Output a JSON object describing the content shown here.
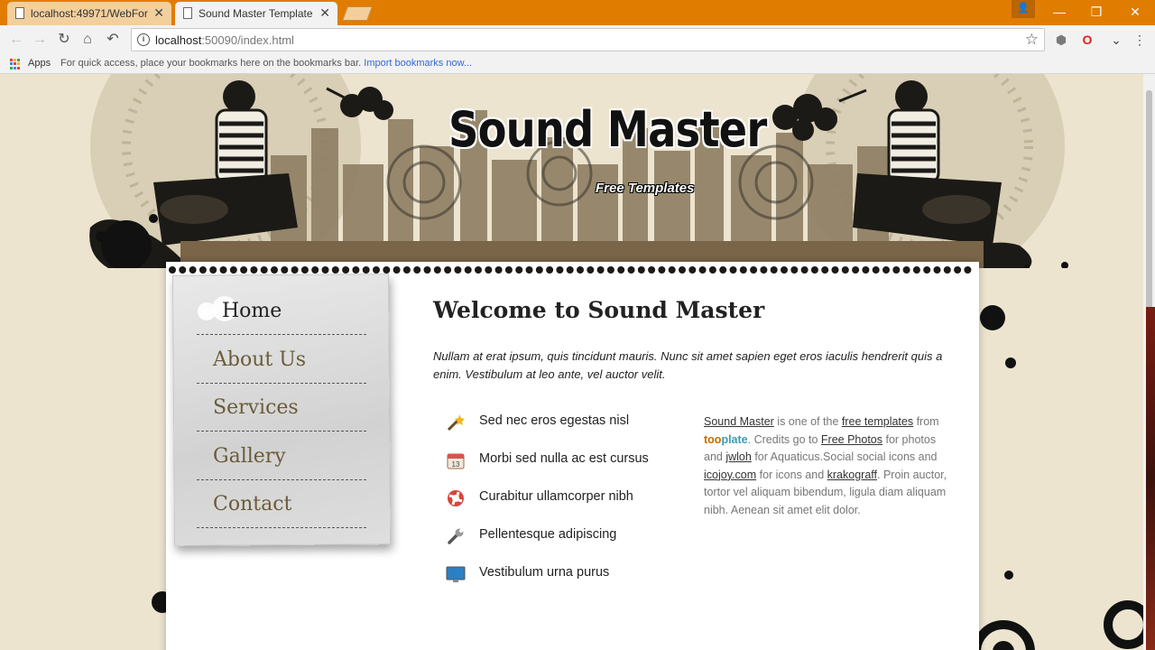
{
  "browser": {
    "tabs": [
      {
        "title": "localhost:49971/WebFor",
        "active": false
      },
      {
        "title": "Sound Master Template",
        "active": true
      }
    ],
    "url_host": "localhost",
    "url_rest": ":50090/index.html",
    "bookmarks": {
      "apps_label": "Apps",
      "hint_text": "For quick access, place your bookmarks here on the bookmarks bar.",
      "import_link": "Import bookmarks now..."
    },
    "colors": {
      "tabstrip": "#e07d00",
      "toolbar": "#f2f2f2"
    }
  },
  "site": {
    "logo_title": "Sound Master",
    "logo_subtitle": "Free Templates",
    "menu": [
      "Home",
      "About Us",
      "Services",
      "Gallery",
      "Contact"
    ],
    "active_menu": "Home",
    "heading": "Welcome to Sound Master",
    "intro": "Nullam at erat ipsum, quis tincidunt mauris. Nunc sit amet sapien eget eros iaculis hendrerit quis a enim. Vestibulum at leo ante, vel auctor velit.",
    "features": [
      {
        "icon": "magic-wand-icon",
        "text": "Sed nec eros egestas nisl"
      },
      {
        "icon": "calendar-icon",
        "text": "Morbi sed nulla ac est cursus"
      },
      {
        "icon": "lifebuoy-icon",
        "text": "Curabitur ullamcorper nibh"
      },
      {
        "icon": "wrench-icon",
        "text": "Pellentesque adipiscing"
      },
      {
        "icon": "monitor-icon",
        "text": "Vestibulum urna purus"
      }
    ],
    "credits": {
      "site_name": "Sound Master",
      "is_one_of": " is one of the ",
      "free_templates": "free templates",
      "from": " from ",
      "too": "too",
      "plate": "plate",
      "credits_go_to": ". Credits go to ",
      "free_photos": "Free Photos",
      "for_photos_and": " for photos and ",
      "jwloh": "jwloh",
      "for_aquaticus": " for Aquaticus.Social social icons and ",
      "icojoy": "icojoy.com",
      "for_icons_and": " for icons and ",
      "krakograff": "krakograff",
      "tail": ". Proin auctor, tortor vel aliquam bibendum, ligula diam aliquam nibh. Aenean sit amet elit dolor."
    },
    "colors": {
      "background": "#ece4cf",
      "menu_text": "#6b5b3a",
      "too_orange": "#c76a00",
      "plate_blue": "#3a9bb6"
    }
  }
}
